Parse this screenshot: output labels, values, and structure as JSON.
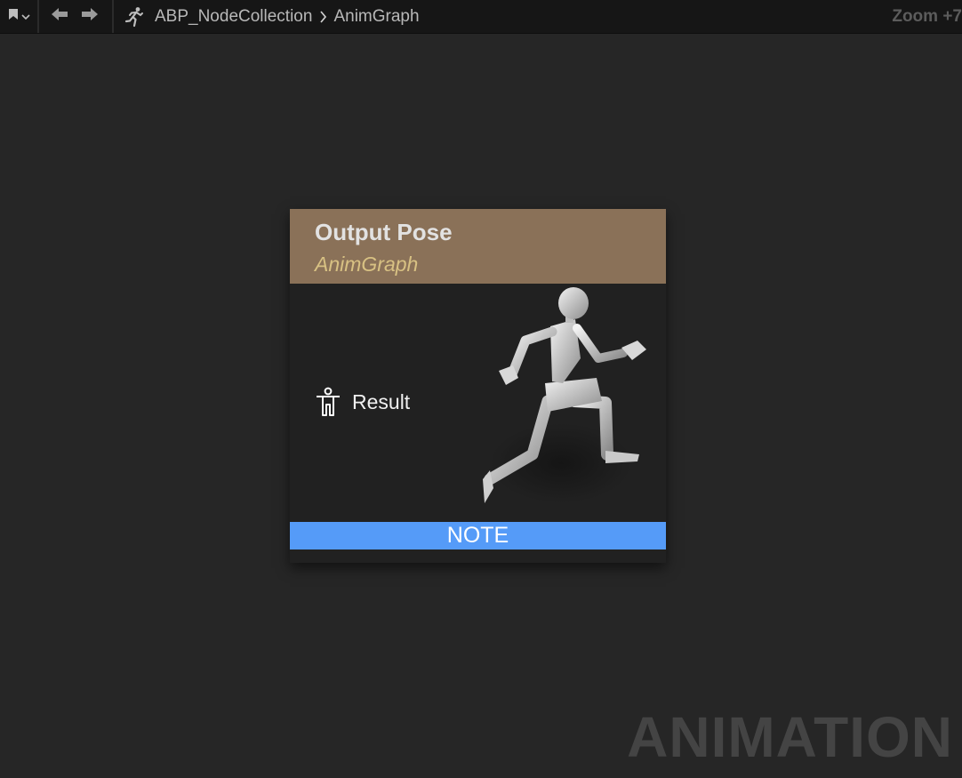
{
  "toolbar": {
    "breadcrumb": {
      "asset": "ABP_NodeCollection",
      "graph": "AnimGraph"
    },
    "zoom_label": "Zoom +7"
  },
  "node": {
    "title": "Output Pose",
    "subtitle": "AnimGraph",
    "header_color": "#8a7158",
    "subtitle_color": "#d8c183",
    "pin_label": "Result",
    "note_label": "NOTE",
    "note_color": "#559bf8"
  },
  "graph": {
    "watermark": "ANIMATION",
    "background_color": "#262626"
  },
  "icons": {
    "bookmark": "bookmark-icon",
    "back": "arrow-left-icon",
    "forward": "arrow-right-icon",
    "anim_asset": "running-man-icon",
    "breadcrumb_separator": "chevron-right-icon",
    "pose_pin": "pose-pin-icon",
    "preview": "mannequin-preview"
  }
}
